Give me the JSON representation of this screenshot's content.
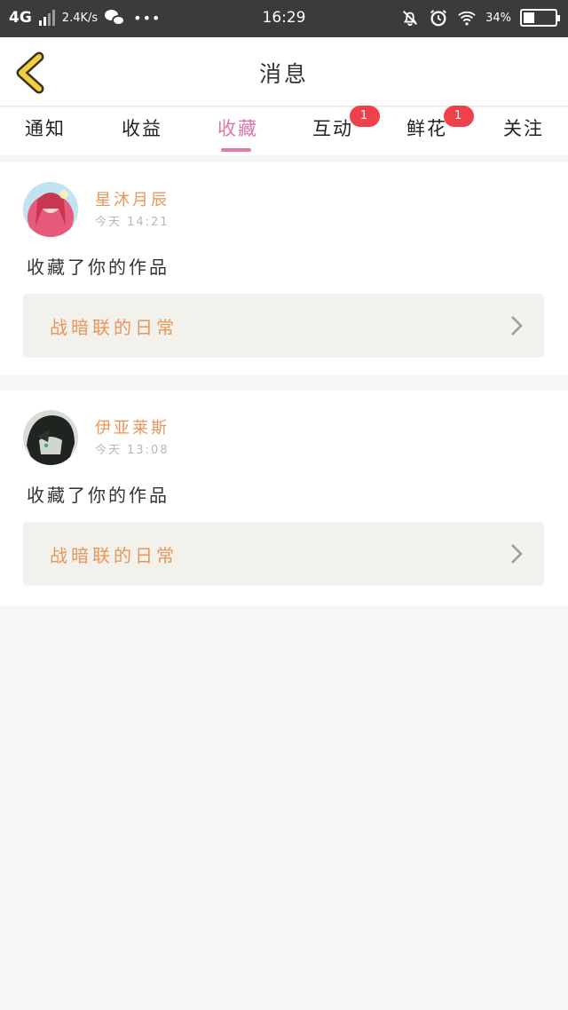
{
  "status_bar": {
    "network": "4G",
    "speed": "2.4K/s",
    "more": "•••",
    "time": "16:29",
    "battery_percent": "34%",
    "battery_level": 0.34,
    "icons": [
      "signal-icon",
      "wechat-icon",
      "mute-bell-icon",
      "alarm-icon",
      "wifi-icon",
      "battery-icon"
    ]
  },
  "header": {
    "title": "消息",
    "back_icon": "chevron-left-icon",
    "back_color": "#f2cf3c"
  },
  "tabs": [
    {
      "label": "通知",
      "badge": ""
    },
    {
      "label": "收益",
      "badge": ""
    },
    {
      "label": "收藏",
      "badge": "",
      "active": true
    },
    {
      "label": "互动",
      "badge": "1"
    },
    {
      "label": "鲜花",
      "badge": "1"
    },
    {
      "label": "关注",
      "badge": ""
    }
  ],
  "messages": [
    {
      "user": "星沐月辰",
      "time": "今天 14:21",
      "action": "收藏了你的作品",
      "work_title": "战暗联的日常"
    },
    {
      "user": "伊亚莱斯",
      "time": "今天 13:08",
      "action": "收藏了你的作品",
      "work_title": "战暗联的日常"
    }
  ],
  "colors": {
    "accent_pink": "#e07aa8",
    "name_orange": "#e8965a",
    "badge_red": "#f0404c",
    "status_bar": "#3b3b3b"
  }
}
